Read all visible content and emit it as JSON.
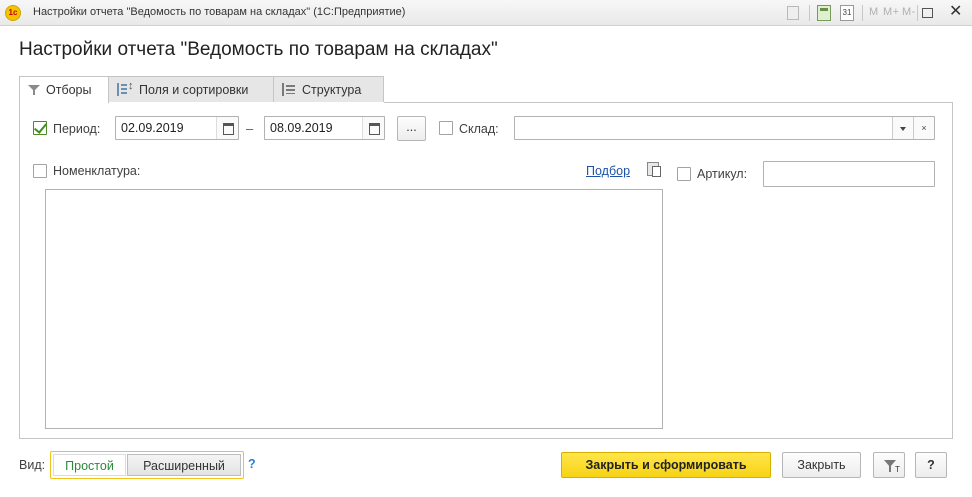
{
  "window": {
    "app_icon_text": "1c",
    "title": "Настройки отчета \"Ведомость по товарам на складах\"  (1С:Предприятие)",
    "toolbar": {
      "doc_icon": "document-icon",
      "calc_icon": "calculator-icon",
      "calendar_icon": "calendar-icon",
      "calendar_text": "31",
      "memory_buttons": [
        "M",
        "M+",
        "M-"
      ],
      "maximize_icon": "maximize-icon",
      "close_glyph": "✕"
    }
  },
  "page": {
    "title": "Настройки отчета \"Ведомость по товарам на складах\""
  },
  "tabs": [
    {
      "label": "Отборы",
      "icon": "filter-icon",
      "active": true
    },
    {
      "label": "Поля и сортировки",
      "icon": "fields-sort-icon",
      "active": false
    },
    {
      "label": "Структура",
      "icon": "structure-icon",
      "active": false
    }
  ],
  "filters": {
    "period": {
      "checked": true,
      "label": "Период:",
      "from": "02.09.2019",
      "separator": "–",
      "to": "08.09.2019",
      "more_button": "..."
    },
    "warehouse": {
      "checked": false,
      "label": "Склад:",
      "value": "",
      "clear_glyph": "×"
    },
    "nomenclature": {
      "checked": false,
      "label": "Номенклатура:",
      "selection_link": "Подбор",
      "items": []
    },
    "article": {
      "checked": false,
      "label": "Артикул:",
      "value": ""
    }
  },
  "footer": {
    "view_label": "Вид:",
    "view_options": [
      "Простой",
      "Расширенный"
    ],
    "view_selected": "Простой",
    "help_mark": "?",
    "primary_button": "Закрыть и сформировать",
    "close_button": "Закрыть",
    "filter_button_sub": "T",
    "help_button": "?"
  },
  "colors": {
    "accent": "#f7d315",
    "link": "#1e54a8",
    "check": "#3f8f1f",
    "selected_view": "#2a8a3a"
  }
}
